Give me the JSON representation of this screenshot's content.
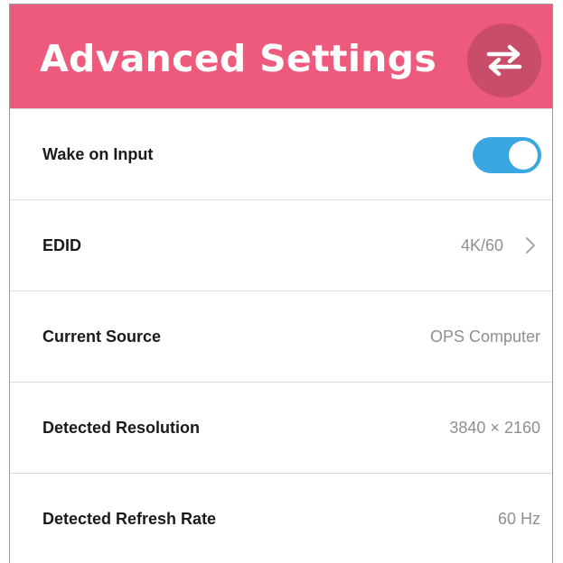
{
  "header": {
    "title": "Advanced Settings",
    "swap_icon": "swap-arrows-icon",
    "background_color": "#ee5a7b"
  },
  "settings": [
    {
      "label": "Wake on Input",
      "type": "toggle",
      "value": true
    },
    {
      "label": "EDID",
      "type": "link",
      "value": "4K/60"
    },
    {
      "label": "Current Source",
      "type": "readonly",
      "value": "OPS Computer"
    },
    {
      "label": "Detected Resolution",
      "type": "readonly",
      "value": "3840 × 2160"
    },
    {
      "label": "Detected Refresh Rate",
      "type": "readonly",
      "value": "60 Hz"
    }
  ],
  "colors": {
    "accent": "#3aa7e0",
    "value_text": "#8f8f8f"
  }
}
